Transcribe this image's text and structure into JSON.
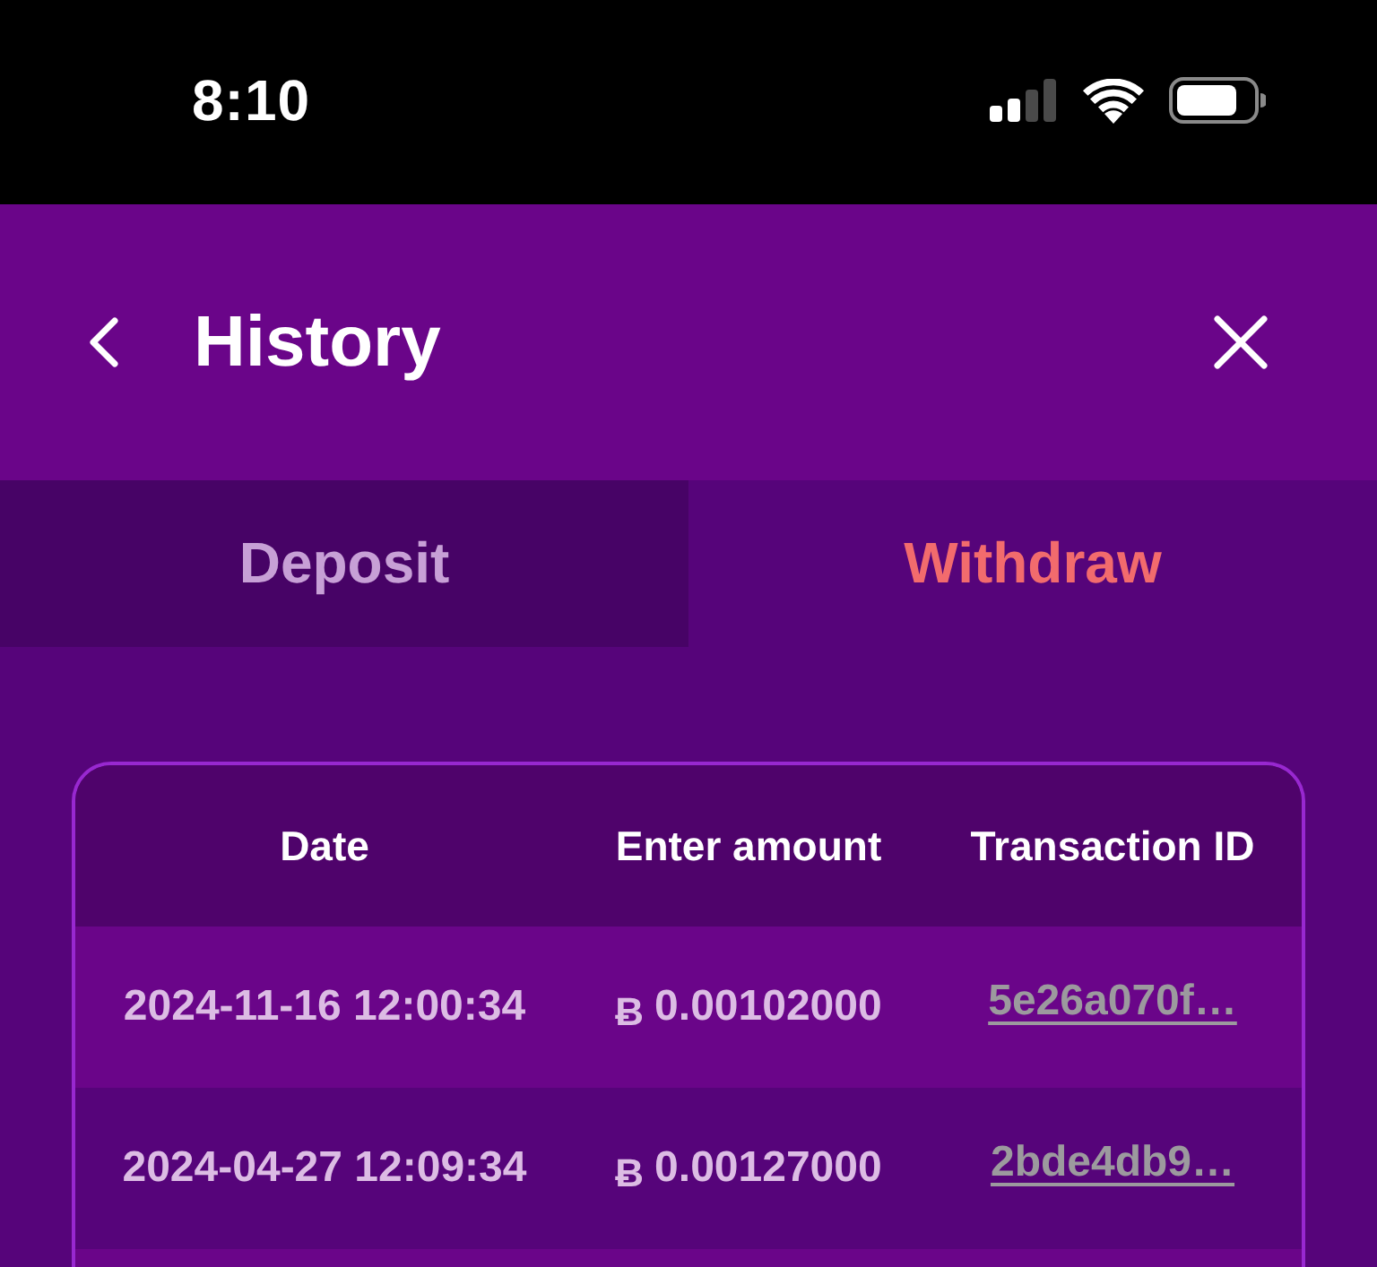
{
  "status_bar": {
    "time": "8:10"
  },
  "header": {
    "title": "History"
  },
  "tabs": [
    {
      "label": "Deposit",
      "selected": false
    },
    {
      "label": "Withdraw",
      "selected": true
    }
  ],
  "table": {
    "columns": [
      "Date",
      "Enter amount",
      "Transaction ID"
    ],
    "rows": [
      {
        "date": "2024-11-16 12:00:34",
        "currency": "Ƀ",
        "amount": "0.00102000",
        "transaction_id": "5e26a070f…"
      },
      {
        "date": "2024-04-27 12:09:34",
        "currency": "Ƀ",
        "amount": "0.00127000",
        "transaction_id": "2bde4db9…"
      }
    ]
  }
}
